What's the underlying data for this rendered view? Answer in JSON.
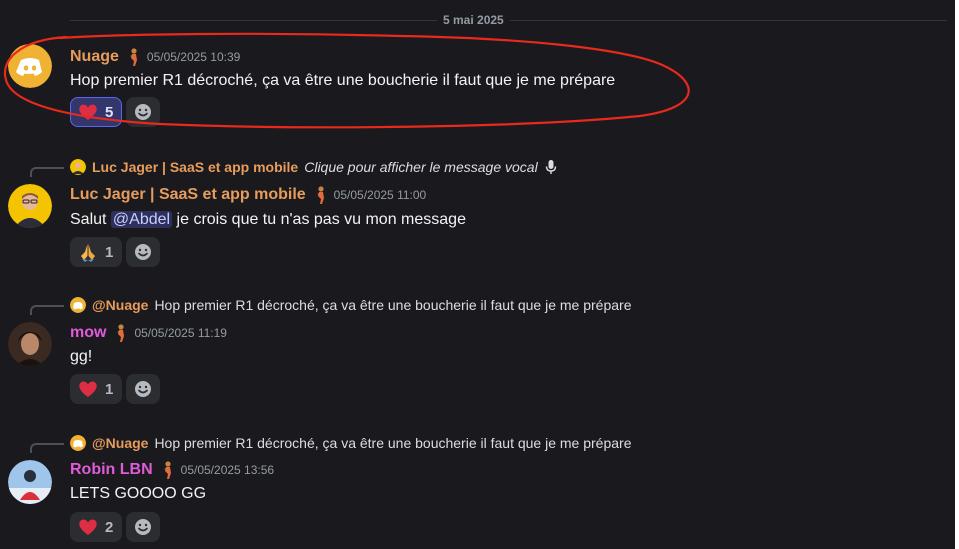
{
  "divider": {
    "date": "5 mai 2025"
  },
  "colors": {
    "background": "#1a1a1e",
    "author_orange": "#e79c5b",
    "author_pink": "#e05bd8",
    "timestamp": "#949ba4",
    "mention_bg": "#3c3f7a",
    "highlight_circle": "#e8291c"
  },
  "messages": [
    {
      "author": "Nuage",
      "timestamp": "05/05/2025 10:39",
      "text": "Hop premier R1 décroché, ça va être une boucherie il faut que je me prépare",
      "avatar_icon": "discord-logo-icon",
      "reactions": [
        {
          "emoji": "heart-icon",
          "count": "5",
          "me": true
        }
      ]
    },
    {
      "reply": {
        "author": "Luc Jager | SaaS et app mobile",
        "text": "Clique pour afficher le message vocal",
        "icon": "microphone-icon"
      },
      "author": "Luc Jager | SaaS et app mobile",
      "timestamp": "05/05/2025 11:00",
      "text_before": "Salut ",
      "mention": "@Abdel",
      "text_after": " je crois que tu n'as pas vu mon message",
      "avatar_icon": "luc-avatar-icon",
      "reactions": [
        {
          "emoji": "praying-hands-icon",
          "count": "1",
          "me": false
        }
      ]
    },
    {
      "reply": {
        "author": "@Nuage",
        "text": "Hop premier R1 décroché, ça va être une boucherie il faut que je me prépare"
      },
      "author": "mow",
      "timestamp": "05/05/2025 11:19",
      "text": "gg!",
      "avatar_icon": "mow-avatar-icon",
      "reactions": [
        {
          "emoji": "heart-icon",
          "count": "1",
          "me": false
        }
      ]
    },
    {
      "reply": {
        "author": "@Nuage",
        "text": "Hop premier R1 décroché, ça va être une boucherie il faut que je me prépare"
      },
      "author": "Robin LBN",
      "timestamp": "05/05/2025 13:56",
      "text": "LETS GOOOO GG",
      "avatar_icon": "robin-avatar-icon",
      "reactions": [
        {
          "emoji": "heart-icon",
          "count": "2",
          "me": false
        }
      ]
    }
  ]
}
